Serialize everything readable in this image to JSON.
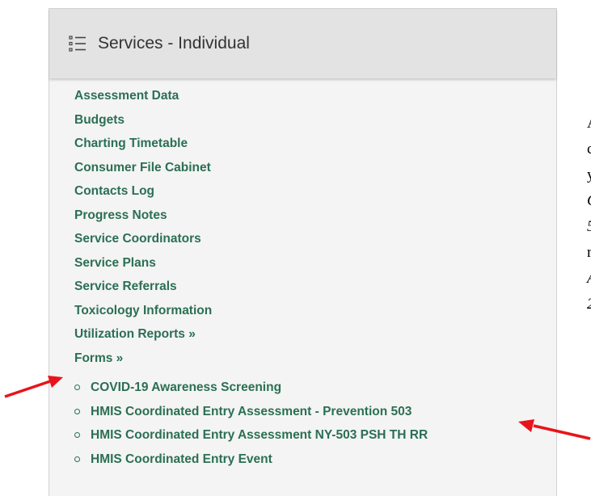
{
  "header": {
    "title": "Services - Individual",
    "icon": "list-icon"
  },
  "menu": {
    "items": [
      {
        "label": "Assessment Data"
      },
      {
        "label": "Budgets"
      },
      {
        "label": "Charting Timetable"
      },
      {
        "label": "Consumer File Cabinet"
      },
      {
        "label": "Contacts Log"
      },
      {
        "label": "Progress Notes"
      },
      {
        "label": "Service Coordinators"
      },
      {
        "label": "Service Plans"
      },
      {
        "label": "Service Referrals"
      },
      {
        "label": "Toxicology Information"
      },
      {
        "label": "Utilization Reports »"
      },
      {
        "label": "Forms »"
      }
    ]
  },
  "forms": {
    "items": [
      {
        "label": "COVID-19 Awareness Screening"
      },
      {
        "label": "HMIS Coordinated Entry Assessment - Prevention 503"
      },
      {
        "label": "HMIS Coordinated Entry Assessment NY-503 PSH TH RR"
      },
      {
        "label": "HMIS Coordinated Entry Event"
      }
    ]
  },
  "side_text": {
    "lines": [
      {
        "text": "A",
        "italic": false
      },
      {
        "text": "c",
        "italic": false
      },
      {
        "text": "y",
        "italic": false
      },
      {
        "text": "C",
        "italic": true
      },
      {
        "text": "5",
        "italic": true
      },
      {
        "text": "r",
        "italic": false
      },
      {
        "text": "A",
        "italic": true
      },
      {
        "text": "2",
        "italic": true
      }
    ]
  },
  "colors": {
    "link": "#2b6f54",
    "arrow": "#e8141b",
    "header_bg": "#e3e3e3",
    "panel_bg": "#f4f4f4"
  }
}
